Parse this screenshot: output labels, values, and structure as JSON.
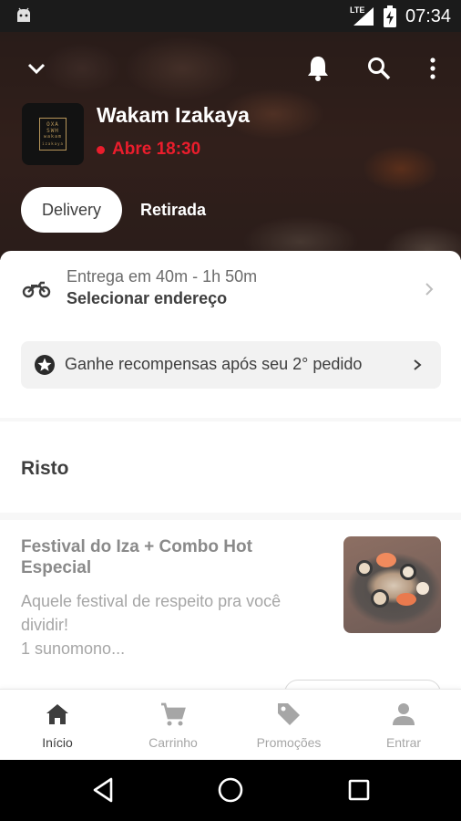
{
  "status_bar": {
    "network": "LTE",
    "time": "07:34"
  },
  "store": {
    "name": "Wakam Izakaya",
    "status": "Abre 18:30",
    "logo_text": [
      "OXA",
      "SWH",
      "wakam",
      "izakaya"
    ]
  },
  "delivery_modes": {
    "delivery": "Delivery",
    "pickup": "Retirada"
  },
  "delivery_info": {
    "eta": "Entrega em 40m - 1h 50m",
    "address": "Selecionar endereço"
  },
  "rewards": {
    "text": "Ganhe recompensas após seu 2° pedido"
  },
  "section": {
    "title": "Risto"
  },
  "product": {
    "name": "Festival do Iza + Combo Hot Especial",
    "desc_line1": "Aquele festival de respeito pra você",
    "desc_line2": "dividir!",
    "desc_line3": "1 sunomono..."
  },
  "bottom_nav": [
    {
      "label": "Início",
      "icon": "home-icon",
      "active": true
    },
    {
      "label": "Carrinho",
      "icon": "cart-icon",
      "active": false
    },
    {
      "label": "Promoções",
      "icon": "tag-icon",
      "active": false
    },
    {
      "label": "Entrar",
      "icon": "person-icon",
      "active": false
    }
  ],
  "colors": {
    "accent_red": "#ea1d2c",
    "text_dark": "#3e3e3e",
    "text_muted": "#a6a6a6"
  }
}
